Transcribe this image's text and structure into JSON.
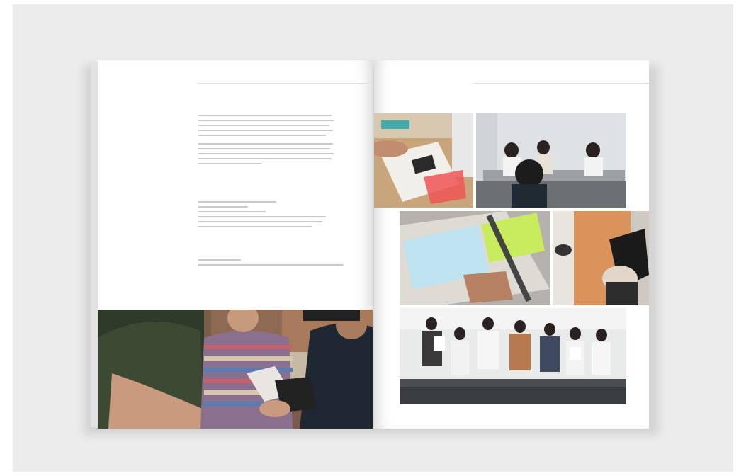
{
  "book": {
    "left_page": {
      "page_number": "",
      "running_head": "",
      "title": "",
      "sections": [
        {
          "label": ""
        },
        {
          "label": ""
        },
        {
          "label": ""
        }
      ]
    },
    "right_page": {
      "page_number": "",
      "running_head": ""
    }
  },
  "colors": {
    "background": "#ececec",
    "paper": "#ffffff",
    "text_gray": "#c9c9c9"
  },
  "photos": [
    "hands-writing-on-paper",
    "students-presenting-at-table",
    "sticky-notes-on-table",
    "hand-holding-camera-device",
    "group-holding-papers",
    "students-looking-at-object"
  ]
}
